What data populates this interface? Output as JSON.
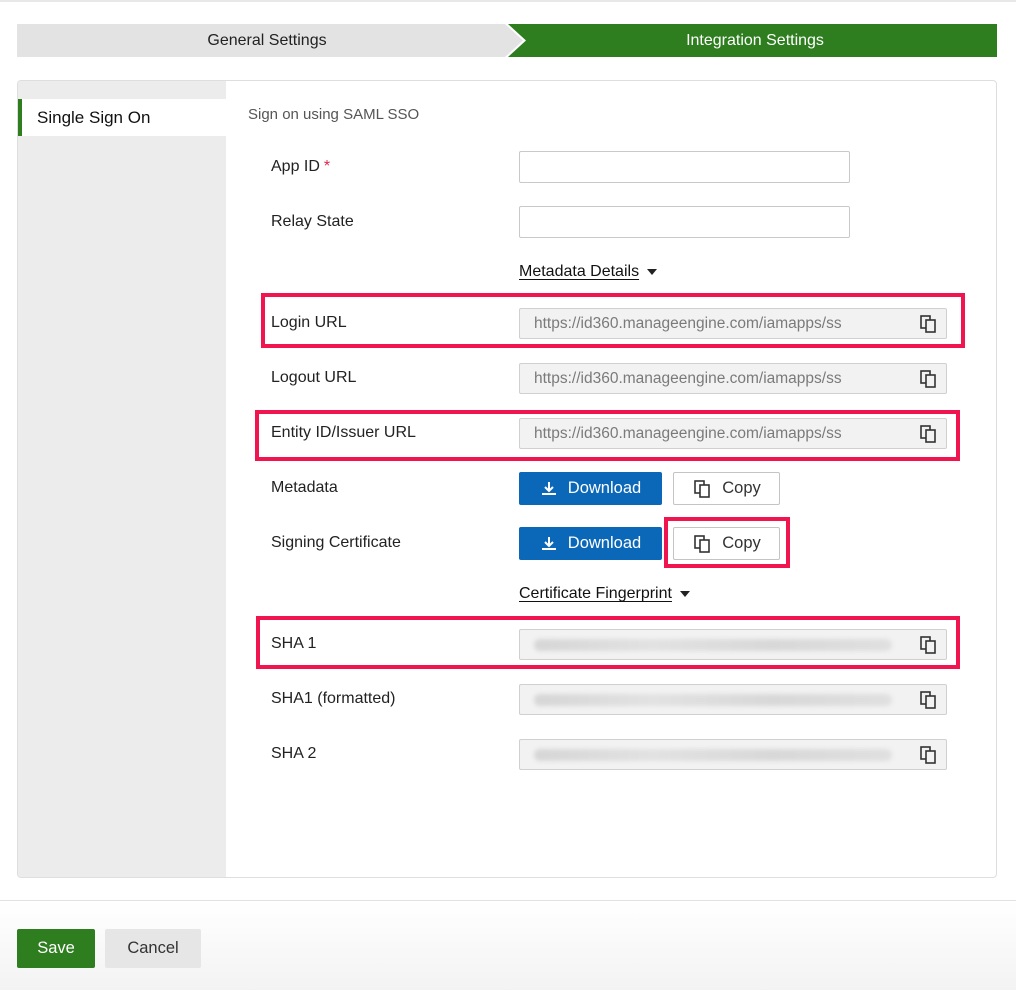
{
  "wizard": {
    "steps": [
      {
        "label": "General Settings",
        "state": "done"
      },
      {
        "label": "Integration Settings",
        "state": "active"
      }
    ],
    "active_color": "#2e7d1f"
  },
  "sidebar": {
    "items": [
      {
        "label": "Single Sign On",
        "selected": true
      }
    ]
  },
  "main": {
    "section_title": "Sign on using SAML SSO",
    "fields": {
      "app_id": {
        "label": "App ID",
        "required_mark": "*",
        "value": ""
      },
      "relay_state": {
        "label": "Relay State",
        "value": ""
      }
    },
    "metadata_toggle": "Metadata Details",
    "urls": {
      "login": {
        "label": "Login URL",
        "value": "https://id360.manageengine.com/iamapps/ss"
      },
      "logout": {
        "label": "Logout URL",
        "value": "https://id360.manageengine.com/iamapps/ss"
      },
      "entity": {
        "label": "Entity ID/Issuer URL",
        "value": "https://id360.manageengine.com/iamapps/ss"
      }
    },
    "metadata": {
      "label": "Metadata",
      "download": "Download",
      "copy": "Copy"
    },
    "signing_certificate": {
      "label": "Signing Certificate",
      "download": "Download",
      "copy": "Copy"
    },
    "fingerprint_toggle": "Certificate Fingerprint",
    "fingerprints": {
      "sha1": {
        "label": "SHA 1"
      },
      "sha1_formatted": {
        "label": "SHA1 (formatted)"
      },
      "sha2": {
        "label": "SHA 2"
      }
    }
  },
  "footer": {
    "save": "Save",
    "cancel": "Cancel"
  },
  "colors": {
    "primary_green": "#2e7d1f",
    "download_blue": "#0b67b8",
    "highlight": "#f0144f"
  }
}
